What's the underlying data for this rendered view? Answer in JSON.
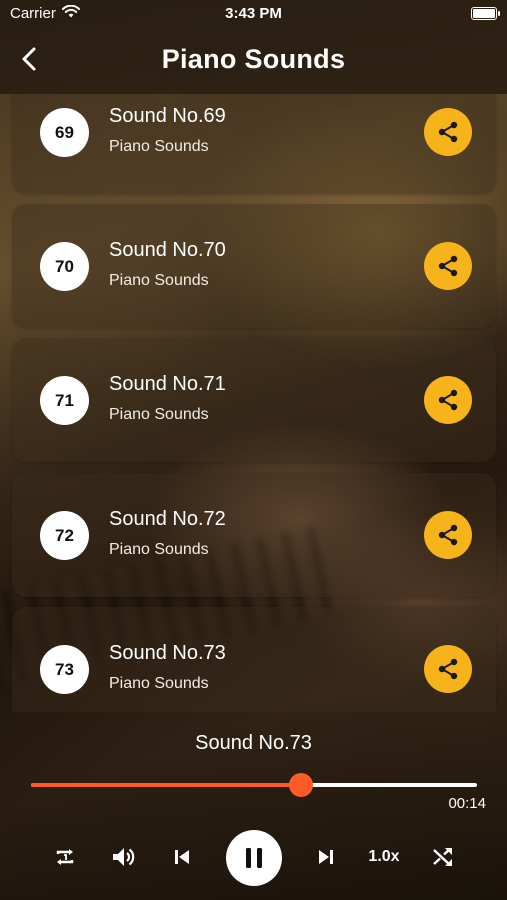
{
  "status_bar": {
    "carrier": "Carrier",
    "time": "3:43 PM",
    "icons": [
      "wifi-icon",
      "battery-icon"
    ]
  },
  "header": {
    "title": "Piano Sounds",
    "back_icon": "chevron-left-icon"
  },
  "sounds": [
    {
      "number": "69",
      "name": "Sound No.69",
      "category": "Piano Sounds"
    },
    {
      "number": "70",
      "name": "Sound No.70",
      "category": "Piano Sounds"
    },
    {
      "number": "71",
      "name": "Sound No.71",
      "category": "Piano Sounds"
    },
    {
      "number": "72",
      "name": "Sound No.72",
      "category": "Piano Sounds"
    },
    {
      "number": "73",
      "name": "Sound No.73",
      "category": "Piano Sounds"
    }
  ],
  "player": {
    "now_playing": "Sound No.73",
    "elapsed": "00:14",
    "progress_fraction": 0.605,
    "speed": "1.0x",
    "controls": [
      "repeat-icon",
      "volume-icon",
      "previous-icon",
      "pause-icon",
      "next-icon",
      "speed-label",
      "shuffle-icon"
    ]
  },
  "colors": {
    "accent": "#f6b41a",
    "progress": "#ff5a2a"
  }
}
